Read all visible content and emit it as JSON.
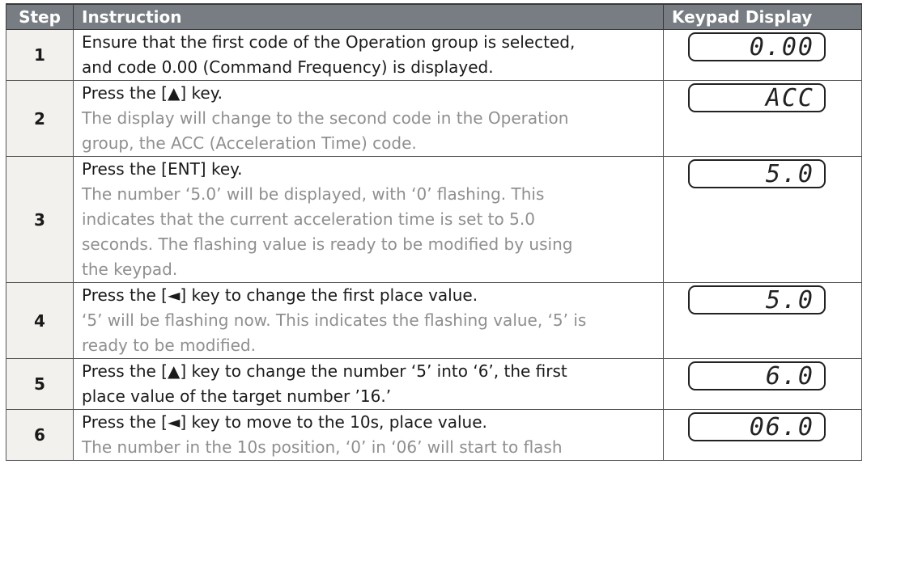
{
  "header": {
    "step": "Step",
    "instruction": "Instruction",
    "display": "Keypad Display"
  },
  "rows": [
    {
      "step": "1",
      "lines": [
        {
          "text": "Ensure that the first code of the Operation group is selected,",
          "muted": false
        },
        {
          "text": "and code 0.00 (Command Frequency) is displayed.",
          "muted": false
        }
      ],
      "display": "0.00"
    },
    {
      "step": "2",
      "lines": [
        {
          "text": "Press the [▲] key.",
          "muted": false
        },
        {
          "text": "The display will change to the second code in the Operation",
          "muted": true
        },
        {
          "text": "group, the ACC (Acceleration Time) code.",
          "muted": true
        }
      ],
      "display": "ACC"
    },
    {
      "step": "3",
      "lines": [
        {
          "text": "Press the [ENT] key.",
          "muted": false
        },
        {
          "text": "The number ‘5.0’ will be displayed, with ‘0’ flashing. This",
          "muted": true
        },
        {
          "text": "indicates that the current acceleration time is set to 5.0",
          "muted": true
        },
        {
          "text": "seconds. The flashing value is ready to be modified by using",
          "muted": true
        },
        {
          "text": "the keypad.",
          "muted": true
        }
      ],
      "display": "5.0"
    },
    {
      "step": "4",
      "lines": [
        {
          "text": "Press the [◄] key to change the first place value.",
          "muted": false
        },
        {
          "text": "‘5’ will be flashing now. This indicates the flashing value, ‘5’ is",
          "muted": true
        },
        {
          "text": "ready to be modified.",
          "muted": true
        }
      ],
      "display": "5.0"
    },
    {
      "step": "5",
      "lines": [
        {
          "text": "Press the [▲] key to change the number ‘5’ into ‘6’, the first",
          "muted": false
        },
        {
          "text": "place value of the target number ’16.’",
          "muted": false
        }
      ],
      "display": "6.0"
    },
    {
      "step": "6",
      "lines": [
        {
          "text": "Press the [◄] key to move to the 10s, place value.",
          "muted": false
        },
        {
          "text": "The number in the 10s position, ‘0’ in ‘06’ will start to flash",
          "muted": true
        }
      ],
      "display": "06.0"
    }
  ]
}
